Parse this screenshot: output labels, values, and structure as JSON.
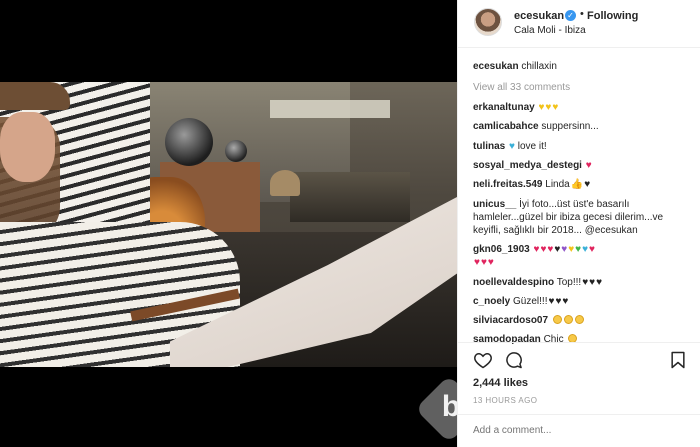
{
  "post": {
    "username": "ecesukan",
    "verified": true,
    "separator": "•",
    "follow_state": "Following",
    "location": "Cala Moli - Ibiza",
    "caption": {
      "user": "ecesukan",
      "text": "chillaxin"
    },
    "view_all": "View all 33 comments",
    "likes": "2,444 likes",
    "timestamp": "13 HOURS AGO",
    "add_comment_placeholder": "Add a comment..."
  },
  "comments": [
    {
      "user": "erkanaltunay",
      "text": "",
      "emoji": [
        "yellow-heart",
        "yellow-heart",
        "yellow-heart"
      ]
    },
    {
      "user": "camlicabahce",
      "text": "suppersinn...",
      "emoji": []
    },
    {
      "user": "tulinas",
      "text": "love it!",
      "emoji_before": [
        "blue-heart"
      ]
    },
    {
      "user": "sosyal_medya_destegi",
      "text": "",
      "emoji": [
        "red-heart"
      ]
    },
    {
      "user": "neli.freitas.549",
      "text": "Linda",
      "emoji": [
        "thumbs-up",
        "black-heart"
      ]
    },
    {
      "user": "unicus__",
      "text": "İyi foto...üst üst'e basarılı",
      "line2": "hamleler...güzel bir ibiza gecesi dilerim...ve",
      "line3": "keyifli, sağlıklı bir 2018... @ecesukan"
    },
    {
      "user": "gkn06_1903",
      "text": "",
      "emoji": [
        "red-heart",
        "red-heart",
        "red-heart",
        "black-heart",
        "purple-heart",
        "yellow-heart",
        "green-heart",
        "blue-heart",
        "red-heart"
      ],
      "line2_emoji": [
        "red-heart",
        "red-heart",
        "red-heart"
      ]
    },
    {
      "user": "noellevaldespino",
      "text": "Top!!!",
      "emoji": [
        "black-heart",
        "black-heart",
        "black-heart"
      ]
    },
    {
      "user": "c_noely",
      "text": "Güzel!!!",
      "emoji": [
        "black-heart",
        "black-heart",
        "black-heart"
      ]
    },
    {
      "user": "silviacardoso07",
      "text": "",
      "emoji": [
        "grin-face",
        "grin-face",
        "grin-face"
      ]
    },
    {
      "user": "samodopadan",
      "text": "Chic",
      "emoji": [
        "smile-face"
      ]
    }
  ],
  "watermark_letter": "b",
  "icons": {
    "like": "heart-outline-icon",
    "comment": "comment-bubble-icon",
    "save": "bookmark-icon",
    "verified": "verified-badge-icon"
  },
  "colors": {
    "accent": "#3897f0",
    "muted": "#999999",
    "text": "#262626",
    "heart_red": "#e0245e"
  }
}
